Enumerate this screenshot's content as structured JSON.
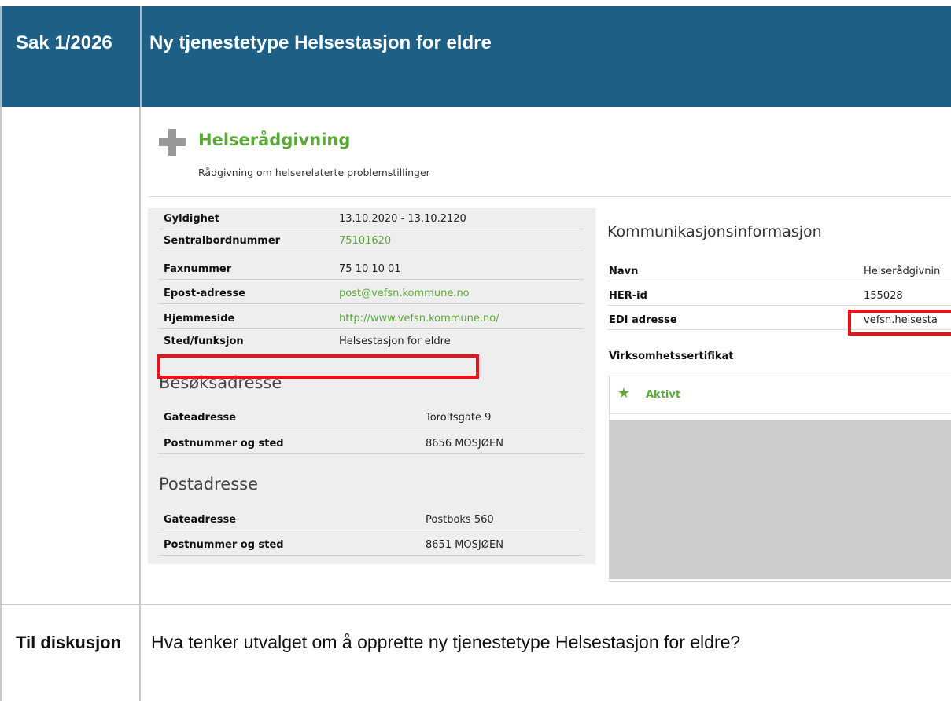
{
  "header": {
    "col1": "Sak 1/2026",
    "col2": "Ny tjenestetype Helsestasjon for eldre"
  },
  "service": {
    "title": "Helserådgivning",
    "subtitle": "Rådgivning om helserelaterte problemstillinger",
    "icon": "plus-icon"
  },
  "details": [
    {
      "label": "Gyldighet",
      "value": "13.10.2020 - 13.10.2120"
    },
    {
      "label": "Sentralbordnummer",
      "value": "75101620"
    },
    {
      "label": "Faxnummer",
      "value": "75 10 10 01"
    },
    {
      "label": "Epost-adresse",
      "value": "post@vefsn.kommune.no"
    },
    {
      "label": "Hjemmeside",
      "value": "http://www.vefsn.kommune.no/"
    },
    {
      "label": "Sted/funksjon",
      "value": "Helsestasjon for eldre"
    }
  ],
  "visit_address": {
    "heading": "Besøksadresse",
    "rows": [
      {
        "label": "Gateadresse",
        "value": "Torolfsgate 9"
      },
      {
        "label": "Postnummer og sted",
        "value": "8656 MOSJØEN"
      }
    ]
  },
  "postal_address": {
    "heading": "Postadresse",
    "rows": [
      {
        "label": "Gateadresse",
        "value": "Postboks 560"
      },
      {
        "label": "Postnummer og sted",
        "value": "8651 MOSJØEN"
      }
    ]
  },
  "communication": {
    "heading": "Kommunikasjonsinformasjon",
    "rows": [
      {
        "label": "Navn",
        "value": "Helserådgivnin"
      },
      {
        "label": "HER-id",
        "value": "155028"
      },
      {
        "label": "EDI adresse",
        "value": "vefsn.helsesta"
      }
    ]
  },
  "certificate": {
    "heading": "Virksomhetssertifikat",
    "status": "Aktivt",
    "status_icon": "star-icon"
  },
  "footer": {
    "col1": "Til diskusjon",
    "col2": "Hva tenker utvalget om å opprette ny tjenestetype Helsestasjon for eldre?"
  },
  "colors": {
    "header_bg": "#1e5f85",
    "accent_green": "#5ba839",
    "highlight_red": "#e8141a"
  }
}
